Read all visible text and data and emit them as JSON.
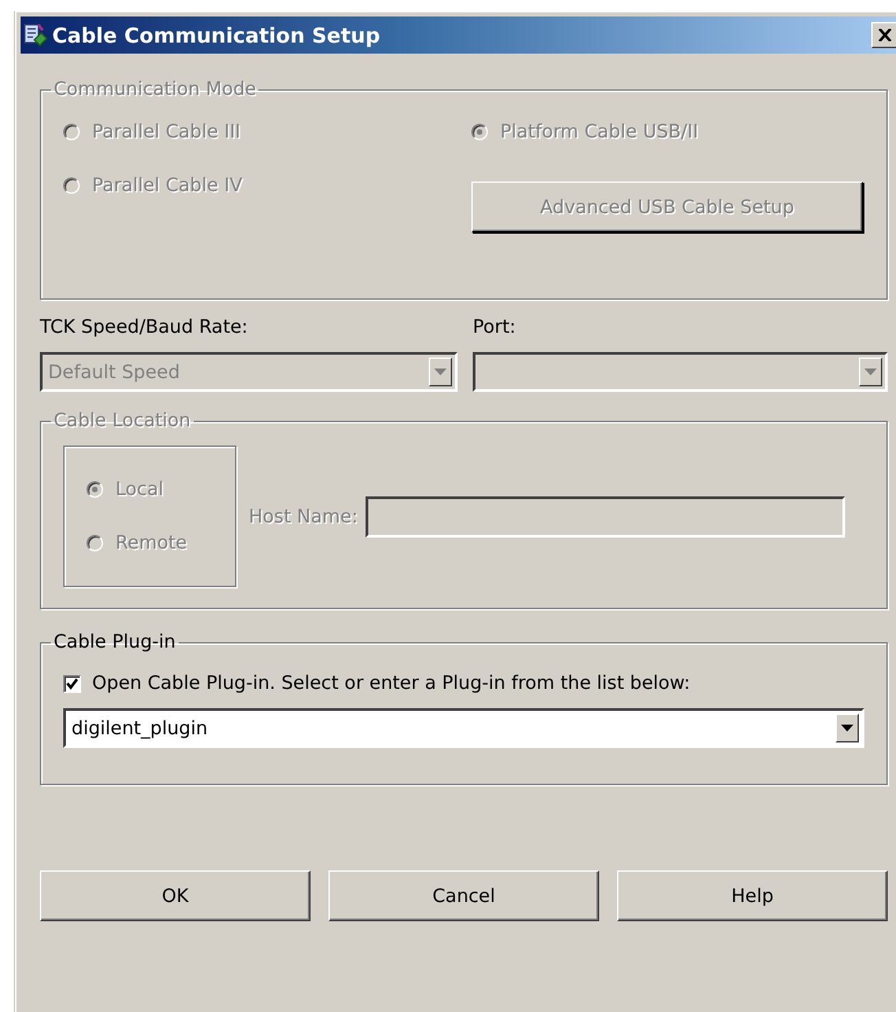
{
  "window": {
    "title": "Cable Communication Setup"
  },
  "communication_mode": {
    "label": "Communication Mode",
    "disabled": true,
    "options": [
      {
        "label": "Parallel Cable III",
        "selected": false
      },
      {
        "label": "Parallel Cable IV",
        "selected": false
      },
      {
        "label": "Platform Cable USB/II",
        "selected": true
      }
    ],
    "advanced_button": {
      "label": "Advanced USB Cable Setup",
      "disabled": true
    }
  },
  "tck_speed": {
    "label": "TCK Speed/Baud Rate:",
    "value": "Default Speed",
    "disabled": true
  },
  "port": {
    "label": "Port:",
    "disabled": true
  },
  "cable_location": {
    "label": "Cable Location",
    "disabled": true,
    "options": [
      {
        "label": "Local",
        "selected": true
      },
      {
        "label": "Remote",
        "selected": false
      }
    ],
    "host_name": {
      "label": "Host Name:"
    }
  },
  "cable_plugin": {
    "label": "Cable Plug-in",
    "disabled": false,
    "checkbox": {
      "label": "Open Cable Plug-in. Select or enter a Plug-in from the list below:",
      "checked": true
    },
    "value": "digilent_plugin"
  },
  "buttons": [
    "OK",
    "Cancel",
    "Help"
  ]
}
